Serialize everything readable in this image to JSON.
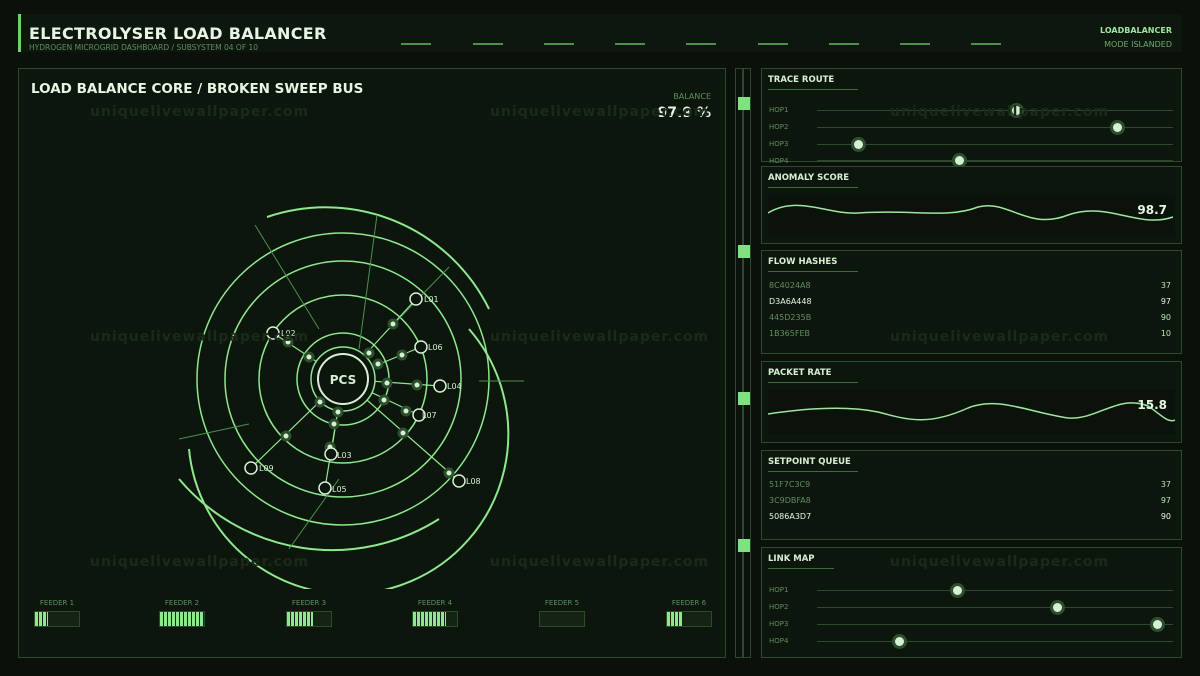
{
  "header": {
    "title": "ELECTROLYSER LOAD BALANCER",
    "subtitle": "HYDROGEN MICROGRID DASHBOARD / SUBSYSTEM 04 OF 10",
    "right_1": "LOADBALANCER",
    "right_2": "MODE ISLANDED"
  },
  "main": {
    "title": "LOAD BALANCE CORE / BROKEN SWEEP BUS",
    "balance_label": "BALANCE",
    "balance_value": "97.9 %",
    "hub_label": "PCS",
    "nodes": [
      "L01",
      "L02",
      "L03",
      "L04",
      "L05",
      "L06",
      "L07",
      "L08",
      "L09"
    ],
    "feeders": [
      {
        "label": "FEEDER 1",
        "fill": 0.3
      },
      {
        "label": "FEEDER 2",
        "fill": 1.0
      },
      {
        "label": "FEEDER 3",
        "fill": 0.6
      },
      {
        "label": "FEEDER 4",
        "fill": 0.75
      },
      {
        "label": "FEEDER 5",
        "fill": 0.0
      },
      {
        "label": "FEEDER 6",
        "fill": 0.35
      }
    ]
  },
  "panels": {
    "trace_route": {
      "title": "TRACE ROUTE",
      "hops": [
        {
          "label": "HOP1",
          "level": 0.55
        },
        {
          "label": "HOP2",
          "level": 0.85
        },
        {
          "label": "HOP3",
          "level": 0.1
        },
        {
          "label": "HOP4",
          "level": 0.4
        }
      ]
    },
    "anomaly_score": {
      "title": "ANOMALY SCORE",
      "value": "98.7"
    },
    "flow_hashes": {
      "title": "FLOW HASHES",
      "rows": [
        {
          "key": "8C4024A8",
          "value": "37",
          "highlight": false
        },
        {
          "key": "D3A6A448",
          "value": "97",
          "highlight": true
        },
        {
          "key": "445D235B",
          "value": "90",
          "highlight": false
        },
        {
          "key": "1B365FEB",
          "value": "10",
          "highlight": false
        }
      ]
    },
    "packet_rate": {
      "title": "PACKET RATE",
      "value": "15.8"
    },
    "setpoint_queue": {
      "title": "SETPOINT QUEUE",
      "rows": [
        {
          "key": "51F7C3C9",
          "value": "37",
          "highlight": false
        },
        {
          "key": "3C9DBFA8",
          "value": "97",
          "highlight": false
        },
        {
          "key": "5086A3D7",
          "value": "90",
          "highlight": true
        }
      ]
    },
    "link_map": {
      "title": "LINK MAP",
      "hops": [
        {
          "label": "HOP1",
          "level": 0.4
        },
        {
          "label": "HOP2",
          "level": 0.7
        },
        {
          "label": "HOP3",
          "level": 1.0
        },
        {
          "label": "HOP4",
          "level": 0.25
        }
      ]
    }
  },
  "watermark": "uniquelivewallpaper.com",
  "colors": {
    "accent": "#7ee27e",
    "text_bright": "#e6f6e4",
    "muted": "#5f8f5f",
    "background": "#0b100b"
  }
}
